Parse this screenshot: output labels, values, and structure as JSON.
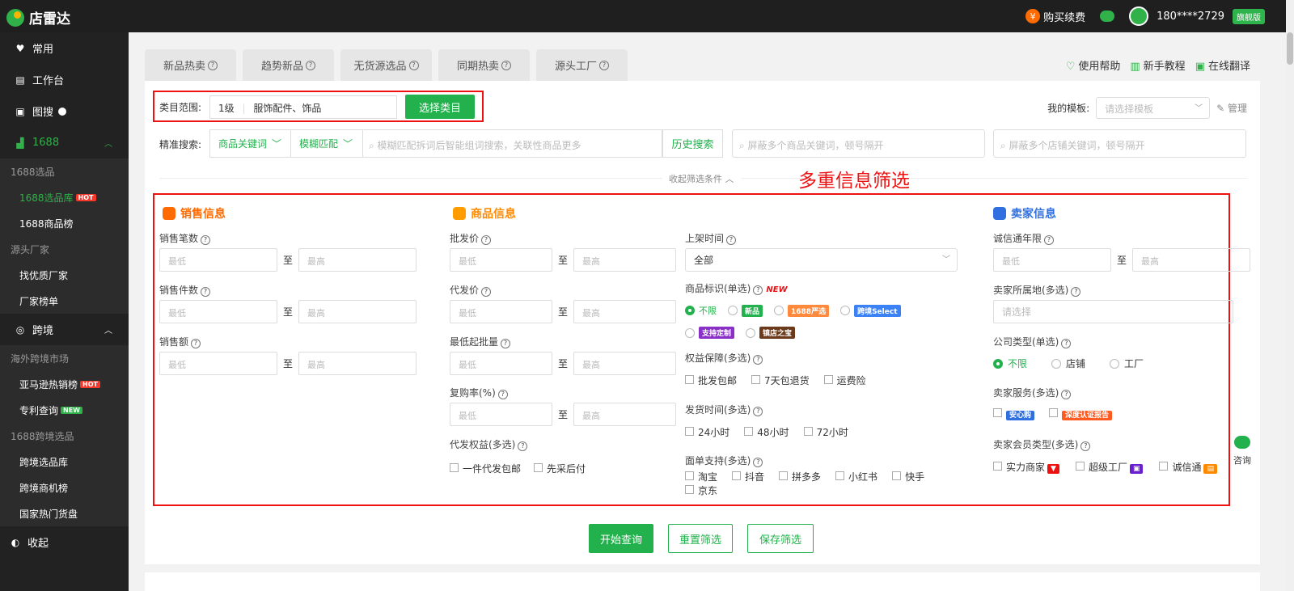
{
  "header": {
    "logo_text": "店雷达",
    "buy_label": "购买续费",
    "coin_symbol": "¥",
    "phone": "180****2729",
    "vip_label": "旗舰版"
  },
  "sidebar": {
    "items": [
      {
        "label": "常用",
        "icon": "heart-icon"
      },
      {
        "label": "工作台",
        "icon": "workbench-icon"
      },
      {
        "label": "图搜",
        "icon": "image-search-icon"
      },
      {
        "label": "1688",
        "icon": "cart-icon"
      }
    ],
    "groups_1688": {
      "group1": "1688选品",
      "sub1": "1688选品库",
      "sub1_badge": "HOT",
      "sub2": "1688商品榜",
      "group2": "源头厂家",
      "sub3": "找优质厂家",
      "sub4": "厂家榜单"
    },
    "cross_border": {
      "label": "跨境",
      "group1": "海外跨境市场",
      "sub1": "亚马逊热销榜",
      "sub1_badge": "HOT",
      "sub2": "专利查询",
      "sub2_badge": "NEW",
      "group2": "1688跨境选品",
      "sub3": "跨境选品库",
      "sub4": "跨境商机榜",
      "sub5": "国家热门货盘"
    },
    "collapse_label": "收起"
  },
  "tabs": [
    "新品热卖",
    "趋势新品",
    "无货源选品",
    "同期热卖",
    "源头工厂"
  ],
  "help_links": [
    "使用帮助",
    "新手教程",
    "在线翻译"
  ],
  "category": {
    "label": "类目范围:",
    "level": "1级",
    "value": "服饰配件、饰品",
    "button": "选择类目"
  },
  "template": {
    "label": "我的模板:",
    "placeholder": "请选择模板",
    "manage": "管理"
  },
  "search": {
    "label": "精准搜索:",
    "type": "商品关键词",
    "match": "模糊匹配",
    "placeholder": "模糊匹配拆词后智能组词搜索，关联性商品更多",
    "history": "历史搜索",
    "block_goods": "屏蔽多个商品关键词，顿号隔开",
    "block_shops": "屏蔽多个店铺关键词，顿号隔开"
  },
  "collapse_filters": "收起筛选条件",
  "annotation_title": "多重信息筛选",
  "filters": {
    "min": "最低",
    "max": "最高",
    "to": "至",
    "sales": {
      "title": "销售信息",
      "f1": "销售笔数",
      "f2": "销售件数",
      "f3": "销售额"
    },
    "goods": {
      "title": "商品信息",
      "f1": "批发价",
      "f2": "代发价",
      "f3": "最低起批量",
      "f4": "复购率(%)",
      "f5": "代发权益(多选)",
      "f5_opts": [
        "一件代发包邮",
        "先采后付"
      ],
      "list_time": "上架时间",
      "list_time_value": "全部",
      "mark_label": "商品标识(单选)",
      "mark_new": "NEW",
      "mark_opts": [
        "不限",
        "新品",
        "1688严选",
        "跨境Select",
        "支持定制",
        "镇店之宝"
      ],
      "rights_label": "权益保障(多选)",
      "rights_opts": [
        "批发包邮",
        "7天包退货",
        "运费险"
      ],
      "ship_label": "发货时间(多选)",
      "ship_opts": [
        "24小时",
        "48小时",
        "72小时"
      ],
      "sheet_label": "面单支持(多选)",
      "sheet_opts": [
        "淘宝",
        "抖音",
        "拼多多",
        "小红书",
        "快手",
        "京东"
      ]
    },
    "seller": {
      "title": "卖家信息",
      "f1": "诚信通年限",
      "f2": "卖家所属地(多选)",
      "f2_placeholder": "请选择",
      "f3": "公司类型(单选)",
      "f3_opts": [
        "不限",
        "店铺",
        "工厂"
      ],
      "f4": "卖家服务(多选)",
      "f4_opts": [
        "安心购",
        "深度认证报告"
      ],
      "f5": "卖家会员类型(多选)",
      "f5_opts": [
        "实力商家",
        "超级工厂",
        "诚信通"
      ]
    }
  },
  "actions": [
    "开始查询",
    "重置筛选",
    "保存筛选"
  ],
  "consult": "咨询",
  "colors": {
    "accent": "#22b14c",
    "annotation": "#e11111",
    "sidebar": "#222222"
  }
}
